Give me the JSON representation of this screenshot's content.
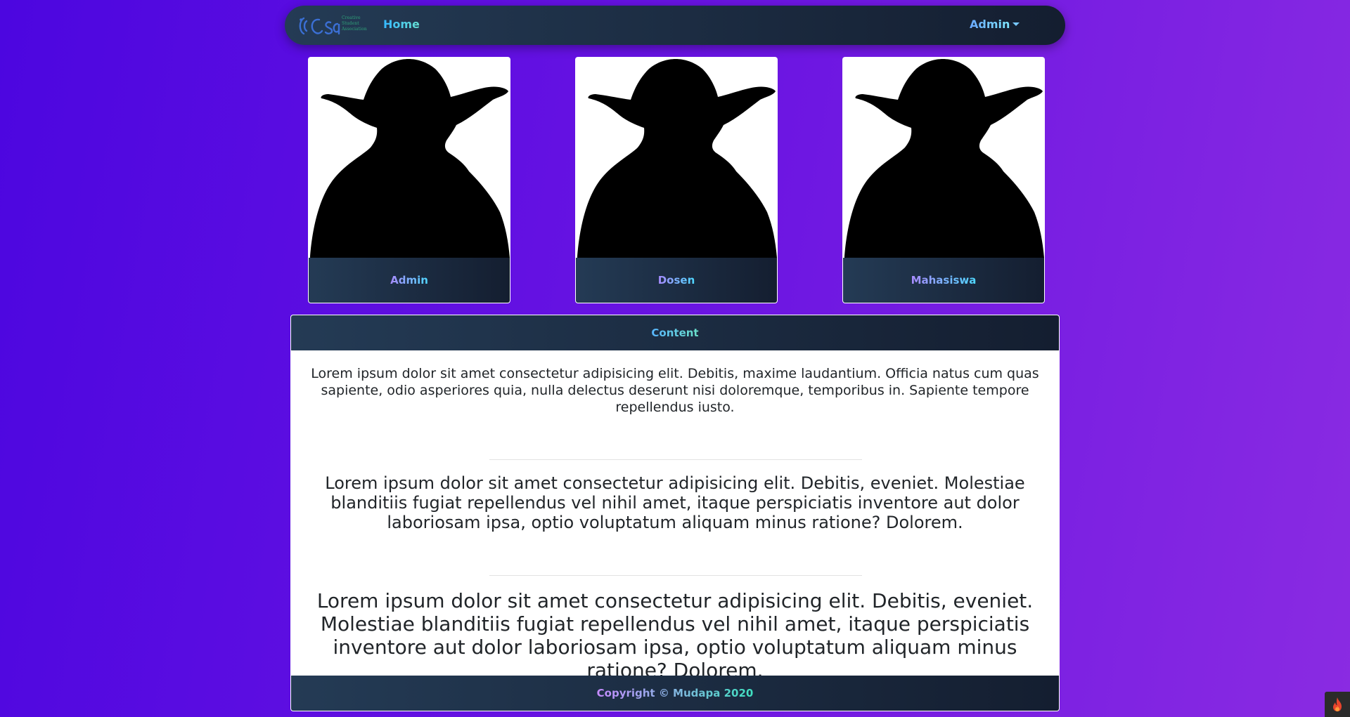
{
  "navbar": {
    "brand_text": "Creative\nStudent\nAssociation",
    "home_label": "Home",
    "admin_label": "Admin"
  },
  "cards": [
    {
      "label": "Admin"
    },
    {
      "label": "Dosen"
    },
    {
      "label": "Mahasiswa"
    }
  ],
  "content": {
    "title": "Content",
    "paragraph_1": "Lorem ipsum dolor sit amet consectetur adipisicing elit. Debitis, maxime laudantium. Officia natus cum quas sapiente, odio asperiores quia, nulla delectus deserunt nisi doloremque, temporibus in. Sapiente tempore repellendus iusto.",
    "paragraph_2": "Lorem ipsum dolor sit amet consectetur adipisicing elit. Debitis, eveniet. Molestiae blanditiis fugiat repellendus vel nihil amet, itaque perspiciatis inventore aut dolor laboriosam ipsa, optio voluptatum aliquam minus ratione? Dolorem.",
    "paragraph_3": "Lorem ipsum dolor sit amet consectetur adipisicing elit. Debitis, eveniet. Molestiae blanditiis fugiat repellendus vel nihil amet, itaque perspiciatis inventore aut dolor laboriosam ipsa, optio voluptatum aliquam minus ratione? Dolorem.",
    "copyright": "Copyright © Mudapa 2020"
  },
  "icons": {
    "brand_logo": "csa-logo-icon",
    "dropdown": "chevron-down-icon",
    "avatar": "yoda-silhouette-icon",
    "corner": "flame-icon"
  },
  "colors": {
    "background_start": "#4c06e0",
    "background_end": "#8a2be2",
    "panel_dark_start": "#243b55",
    "panel_dark_end": "#141e30"
  }
}
